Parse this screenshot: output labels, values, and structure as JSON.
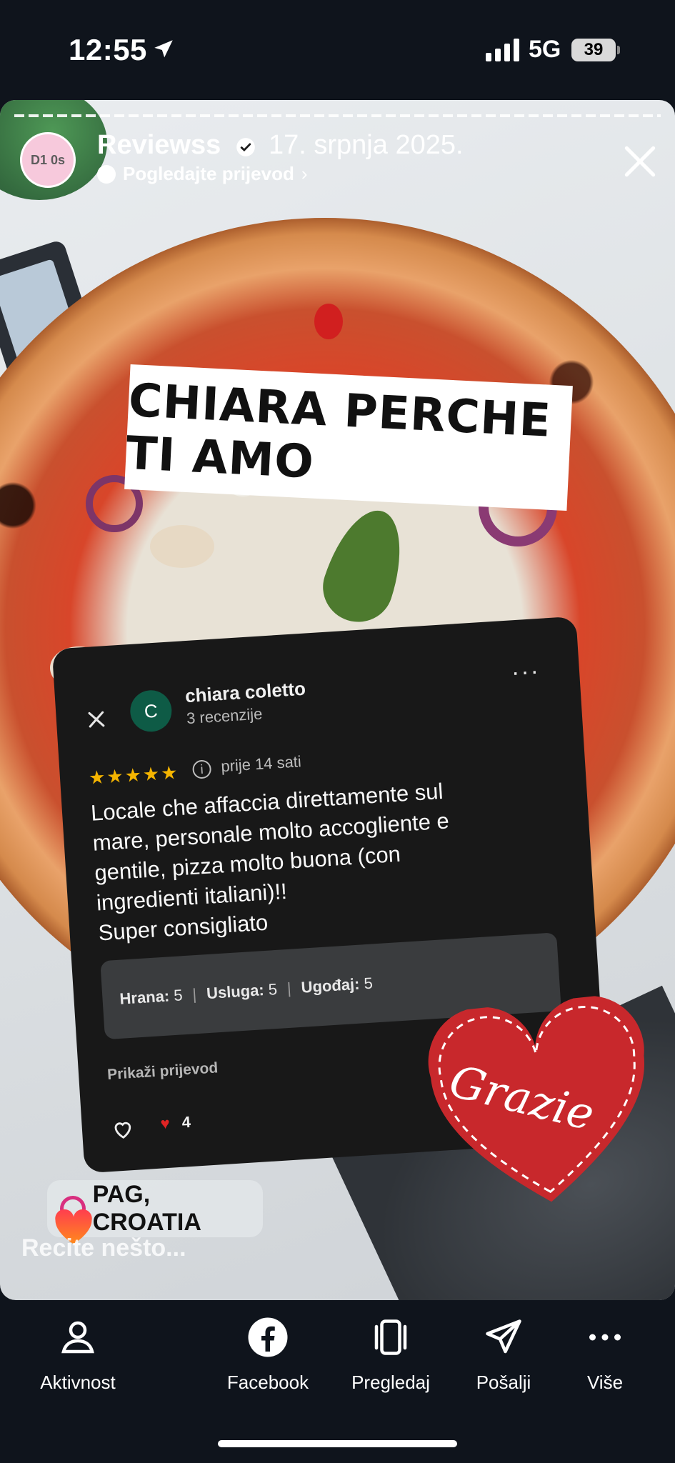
{
  "status_bar": {
    "time": "12:55",
    "network": "5G",
    "battery": "39"
  },
  "story": {
    "account_name": "Reviewss",
    "date": "17. srpnja 2025.",
    "translate_label": "Pogledajte prijevod",
    "avatar_text": "D1 0s",
    "sticker_text": "CHIARA PERCHE TI AMO",
    "reply_placeholder": "Recite nešto...",
    "location": "PAG, CROATIA",
    "heart_sticker_text": "Grazie"
  },
  "review": {
    "initial": "C",
    "name": "chiara coletto",
    "review_count": "3 recenzije",
    "stars": "★★★★★",
    "time": "prije 14 sati",
    "body_lines": [
      "Locale che affaccia direttamente sul",
      "mare, personale molto accogliente e",
      "gentile, pizza molto buona (con",
      "ingredienti italiani)!!",
      "Super consigliato"
    ],
    "ratings": [
      {
        "label": "Hrana:",
        "value": "5"
      },
      {
        "label": "Usluga:",
        "value": "5"
      },
      {
        "label": "Ugođaj:",
        "value": "5"
      }
    ],
    "translate_label": "Prikaži prijevod",
    "likes": "4"
  },
  "bottom_bar": {
    "items": [
      {
        "label": "Aktivnost",
        "icon": "activity-icon"
      },
      {
        "label": "Facebook",
        "icon": "facebook-icon"
      },
      {
        "label": "Pregledaj",
        "icon": "preview-icon"
      },
      {
        "label": "Pošalji",
        "icon": "send-icon"
      },
      {
        "label": "Više",
        "icon": "more-icon"
      }
    ]
  },
  "colors": {
    "background": "#0f141c",
    "review_card": "#181818",
    "star": "#f4b400",
    "heart": "#c8282c",
    "avatar_green": "#0e5b46"
  }
}
